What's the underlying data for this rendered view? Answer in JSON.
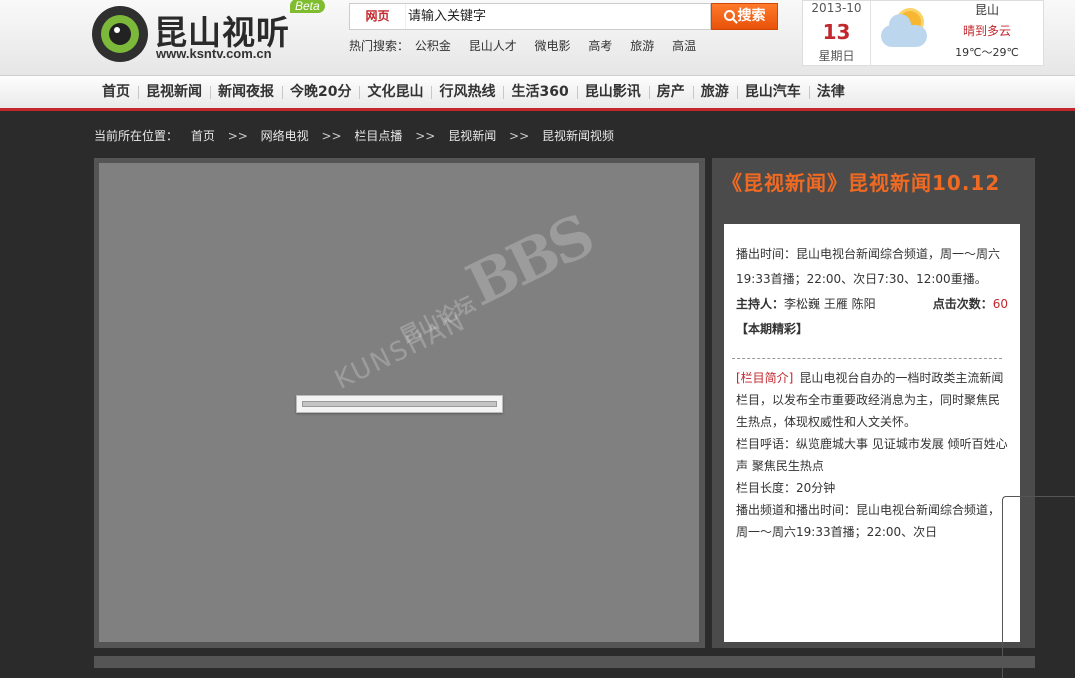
{
  "header": {
    "logo_text": "昆山视听",
    "logo_url": "www.ksntv.com.cn",
    "beta": "Beta"
  },
  "search": {
    "type_label": "网页",
    "placeholder": "请输入关键字",
    "button_label": "搜索",
    "hot_label": "热门搜索：",
    "hot_terms": [
      "公积金",
      "昆山人才",
      "微电影",
      "高考",
      "旅游",
      "高温"
    ]
  },
  "weather": {
    "year_month": "2013-10",
    "day": "13",
    "weekday": "星期日",
    "city": "昆山",
    "condition": "晴到多云",
    "temp": "19℃～29℃",
    "icon": "partly-cloudy-icon"
  },
  "nav": {
    "items": [
      "首页",
      "昆视新闻",
      "新闻夜报",
      "今晚20分",
      "文化昆山",
      "行风热线",
      "生活360",
      "昆山影讯",
      "房产",
      "旅游",
      "昆山汽车",
      "法律"
    ]
  },
  "breadcrumb": {
    "label": "当前所在位置：",
    "items": [
      "首页",
      "网络电视",
      "栏目点播",
      "昆视新闻",
      "昆视新闻视频"
    ],
    "separator": ">>"
  },
  "player": {
    "watermark_cn": "昆山论坛",
    "watermark_en": "KUNSHAN",
    "watermark_bbs": "BBS"
  },
  "detail": {
    "title": "《昆视新闻》昆视新闻10.12",
    "broadcast": "播出时间：昆山电视台新闻综合频道，周一～周六19:33首播；22:00、次日7:30、12:00重播。",
    "hosts_label": "主持人：",
    "hosts": "李松巍 王雁 陈阳",
    "hits_label": "点击次数：",
    "hits": "60",
    "highlight_label": "【本期精彩】",
    "intro_tag": "[栏目简介]",
    "intro": "昆山电视台自办的一档时政类主流新闻栏目，以发布全市重要政经消息为主，同时聚焦民生热点，体现权威性和人文关怀。",
    "slogan": "栏目呼语：纵览鹿城大事 见证城市发展 倾听百姓心声 聚焦民生热点",
    "length": "栏目长度：20分钟",
    "channel_time": "播出频道和播出时间：昆山电视台新闻综合频道，周一～周六19:33首播；22:00、次日"
  },
  "colors": {
    "accent": "#c1272d",
    "orange": "#f06a22",
    "brand_green": "#7fbd2e"
  }
}
